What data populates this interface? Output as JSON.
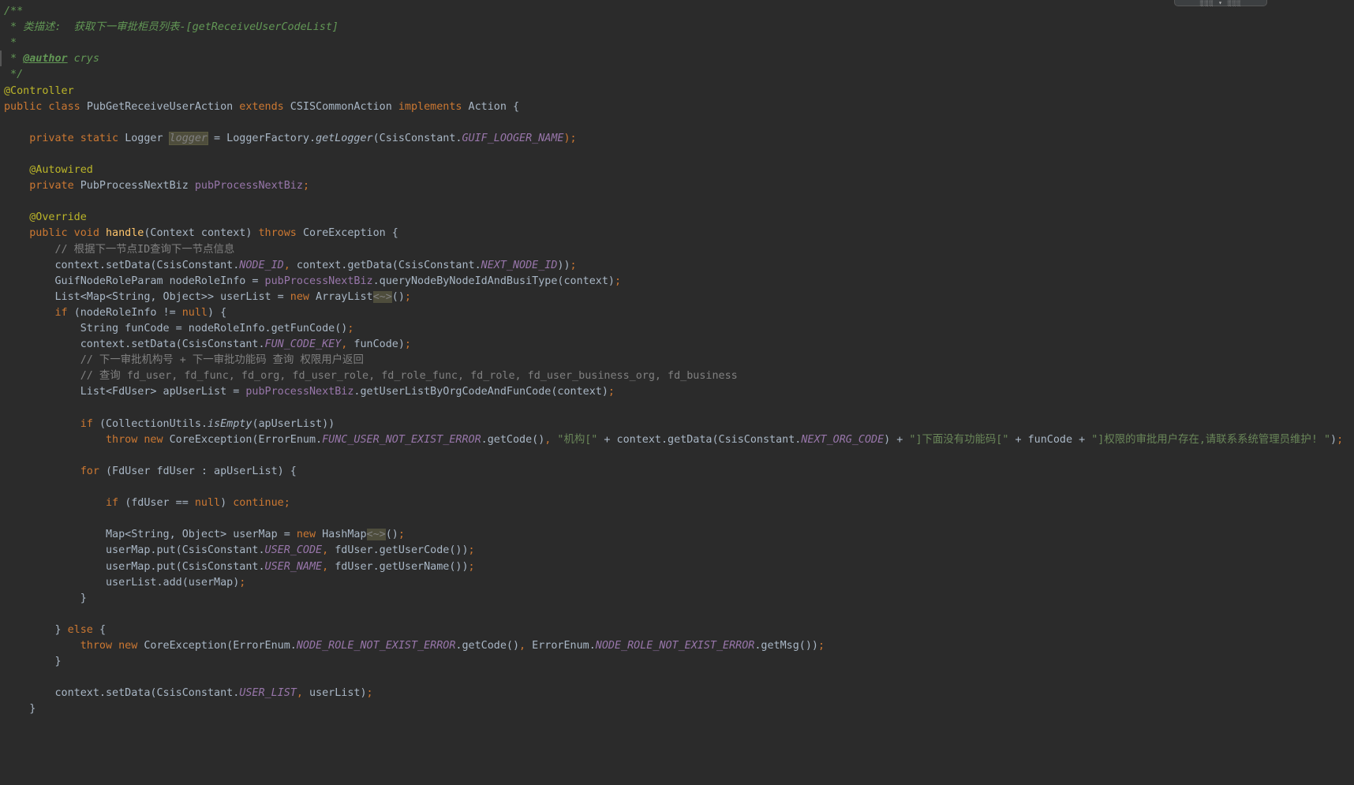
{
  "editor": {
    "colors": {
      "background": "#2b2b2b",
      "keyword": "#cc7832",
      "annotation": "#bbb529",
      "doc_comment": "#629755",
      "line_comment": "#808080",
      "field": "#9876aa",
      "method_decl": "#ffc66d",
      "string": "#6a8759",
      "default": "#a9b7c6"
    },
    "toolbar_glyphs": "░░░ ▾ ░░░",
    "lines": [
      [
        {
          "t": "/**",
          "c": "cm"
        }
      ],
      [
        {
          "t": " * 类描述:  获取下一审批柜员列表-[getReceiveUserCodeList]",
          "c": "cm"
        }
      ],
      [
        {
          "t": " *",
          "c": "cm"
        }
      ],
      [
        {
          "t": " * ",
          "c": "cm"
        },
        {
          "t": "@author",
          "c": "cm-tag"
        },
        {
          "t": " crys",
          "c": "cm"
        }
      ],
      [
        {
          "t": " */",
          "c": "cm"
        }
      ],
      [
        {
          "t": "@Controller",
          "c": "ann"
        }
      ],
      [
        {
          "t": "public class ",
          "c": "kw"
        },
        {
          "t": "PubGetReceiveUserAction ",
          "c": ""
        },
        {
          "t": "extends ",
          "c": "kw"
        },
        {
          "t": "CSISCommonAction ",
          "c": ""
        },
        {
          "t": "implements ",
          "c": "kw"
        },
        {
          "t": "Action {",
          "c": ""
        }
      ],
      [],
      [
        {
          "t": "    ",
          "c": ""
        },
        {
          "t": "private static ",
          "c": "kw"
        },
        {
          "t": "Logger ",
          "c": ""
        },
        {
          "t": "logger",
          "c": "hl-logger"
        },
        {
          "t": " = LoggerFactory.",
          "c": ""
        },
        {
          "t": "getLogger",
          "c": "static-call"
        },
        {
          "t": "(CsisConstant.",
          "c": ""
        },
        {
          "t": "GUIF_LOOGER_NAME",
          "c": "const"
        },
        {
          "t": ");",
          "c": "kw"
        }
      ],
      [],
      [
        {
          "t": "    ",
          "c": ""
        },
        {
          "t": "@Autowired",
          "c": "ann"
        }
      ],
      [
        {
          "t": "    ",
          "c": ""
        },
        {
          "t": "private ",
          "c": "kw"
        },
        {
          "t": "PubProcessNextBiz ",
          "c": ""
        },
        {
          "t": "pubProcessNextBiz",
          "c": "field"
        },
        {
          "t": ";",
          "c": "kw"
        }
      ],
      [],
      [
        {
          "t": "    ",
          "c": ""
        },
        {
          "t": "@Override",
          "c": "ann"
        }
      ],
      [
        {
          "t": "    ",
          "c": ""
        },
        {
          "t": "public void ",
          "c": "kw"
        },
        {
          "t": "handle",
          "c": "method"
        },
        {
          "t": "(Context context) ",
          "c": ""
        },
        {
          "t": "throws ",
          "c": "kw"
        },
        {
          "t": "CoreException {",
          "c": ""
        }
      ],
      [
        {
          "t": "        // 根据下一节点ID查询下一节点信息",
          "c": "lc"
        }
      ],
      [
        {
          "t": "        context.setData(CsisConstant.",
          "c": ""
        },
        {
          "t": "NODE_ID",
          "c": "const"
        },
        {
          "t": ", ",
          "c": "kw"
        },
        {
          "t": "context.getData(CsisConstant.",
          "c": ""
        },
        {
          "t": "NEXT_NODE_ID",
          "c": "const"
        },
        {
          "t": "))",
          "c": ""
        },
        {
          "t": ";",
          "c": "kw"
        }
      ],
      [
        {
          "t": "        GuifNodeRoleParam nodeRoleInfo = ",
          "c": ""
        },
        {
          "t": "pubProcessNextBiz",
          "c": "field"
        },
        {
          "t": ".queryNodeByNodeIdAndBusiType(context)",
          "c": ""
        },
        {
          "t": ";",
          "c": "kw"
        }
      ],
      [
        {
          "t": "        List<Map<String, Object>> userList = ",
          "c": ""
        },
        {
          "t": "new ",
          "c": "kw"
        },
        {
          "t": "ArrayList",
          "c": ""
        },
        {
          "t": "<~>",
          "c": "hl-diamond"
        },
        {
          "t": "()",
          "c": ""
        },
        {
          "t": ";",
          "c": "kw"
        }
      ],
      [
        {
          "t": "        ",
          "c": ""
        },
        {
          "t": "if ",
          "c": "kw"
        },
        {
          "t": "(nodeRoleInfo != ",
          "c": ""
        },
        {
          "t": "null",
          "c": "kw"
        },
        {
          "t": ") {",
          "c": ""
        }
      ],
      [
        {
          "t": "            String funCode = nodeRoleInfo.getFunCode()",
          "c": ""
        },
        {
          "t": ";",
          "c": "kw"
        }
      ],
      [
        {
          "t": "            context.setData(CsisConstant.",
          "c": ""
        },
        {
          "t": "FUN_CODE_KEY",
          "c": "const"
        },
        {
          "t": ", ",
          "c": "kw"
        },
        {
          "t": "funCode)",
          "c": ""
        },
        {
          "t": ";",
          "c": "kw"
        }
      ],
      [
        {
          "t": "            // 下一审批机构号 + 下一审批功能码 查询 权限用户返回",
          "c": "lc"
        }
      ],
      [
        {
          "t": "            // 查询 fd_user, fd_func, fd_org, fd_user_role, fd_role_func, fd_role, fd_user_business_org, fd_business",
          "c": "lc"
        }
      ],
      [
        {
          "t": "            List<FdUser> apUserList = ",
          "c": ""
        },
        {
          "t": "pubProcessNextBiz",
          "c": "field"
        },
        {
          "t": ".getUserListByOrgCodeAndFunCode(context)",
          "c": ""
        },
        {
          "t": ";",
          "c": "kw"
        }
      ],
      [],
      [
        {
          "t": "            ",
          "c": ""
        },
        {
          "t": "if ",
          "c": "kw"
        },
        {
          "t": "(CollectionUtils.",
          "c": ""
        },
        {
          "t": "isEmpty",
          "c": "static-call"
        },
        {
          "t": "(apUserList))",
          "c": ""
        }
      ],
      [
        {
          "t": "                ",
          "c": ""
        },
        {
          "t": "throw new ",
          "c": "kw"
        },
        {
          "t": "CoreException(ErrorEnum.",
          "c": ""
        },
        {
          "t": "FUNC_USER_NOT_EXIST_ERROR",
          "c": "const"
        },
        {
          "t": ".getCode()",
          "c": ""
        },
        {
          "t": ", ",
          "c": "kw"
        },
        {
          "t": "\"机构[\"",
          "c": "str"
        },
        {
          "t": " + context.getData(CsisConstant.",
          "c": ""
        },
        {
          "t": "NEXT_ORG_CODE",
          "c": "const"
        },
        {
          "t": ") + ",
          "c": ""
        },
        {
          "t": "\"]下面没有功能码[\"",
          "c": "str"
        },
        {
          "t": " + funCode + ",
          "c": ""
        },
        {
          "t": "\"]权限的审批用户存在,请联系系统管理员维护! \"",
          "c": "str"
        },
        {
          "t": ")",
          "c": ""
        },
        {
          "t": ";",
          "c": "kw"
        }
      ],
      [],
      [
        {
          "t": "            ",
          "c": ""
        },
        {
          "t": "for ",
          "c": "kw"
        },
        {
          "t": "(FdUser fdUser : apUserList) {",
          "c": ""
        }
      ],
      [],
      [
        {
          "t": "                ",
          "c": ""
        },
        {
          "t": "if ",
          "c": "kw"
        },
        {
          "t": "(fdUser == ",
          "c": ""
        },
        {
          "t": "null",
          "c": "kw"
        },
        {
          "t": ") ",
          "c": ""
        },
        {
          "t": "continue;",
          "c": "kw"
        }
      ],
      [],
      [
        {
          "t": "                Map<String, Object> userMap = ",
          "c": ""
        },
        {
          "t": "new ",
          "c": "kw"
        },
        {
          "t": "HashMap",
          "c": ""
        },
        {
          "t": "<~>",
          "c": "hl-diamond"
        },
        {
          "t": "()",
          "c": ""
        },
        {
          "t": ";",
          "c": "kw"
        }
      ],
      [
        {
          "t": "                userMap.put(CsisConstant.",
          "c": ""
        },
        {
          "t": "USER_CODE",
          "c": "const"
        },
        {
          "t": ", ",
          "c": "kw"
        },
        {
          "t": "fdUser.getUserCode())",
          "c": ""
        },
        {
          "t": ";",
          "c": "kw"
        }
      ],
      [
        {
          "t": "                userMap.put(CsisConstant.",
          "c": ""
        },
        {
          "t": "USER_NAME",
          "c": "const"
        },
        {
          "t": ", ",
          "c": "kw"
        },
        {
          "t": "fdUser.getUserName())",
          "c": ""
        },
        {
          "t": ";",
          "c": "kw"
        }
      ],
      [
        {
          "t": "                userList.add(userMap)",
          "c": ""
        },
        {
          "t": ";",
          "c": "kw"
        }
      ],
      [
        {
          "t": "            }",
          "c": ""
        }
      ],
      [],
      [
        {
          "t": "        } ",
          "c": ""
        },
        {
          "t": "else ",
          "c": "kw"
        },
        {
          "t": "{",
          "c": ""
        }
      ],
      [
        {
          "t": "            ",
          "c": ""
        },
        {
          "t": "throw new ",
          "c": "kw"
        },
        {
          "t": "CoreException(ErrorEnum.",
          "c": ""
        },
        {
          "t": "NODE_ROLE_NOT_EXIST_ERROR",
          "c": "const"
        },
        {
          "t": ".getCode()",
          "c": ""
        },
        {
          "t": ", ",
          "c": "kw"
        },
        {
          "t": "ErrorEnum.",
          "c": ""
        },
        {
          "t": "NODE_ROLE_NOT_EXIST_ERROR",
          "c": "const"
        },
        {
          "t": ".getMsg())",
          "c": ""
        },
        {
          "t": ";",
          "c": "kw"
        }
      ],
      [
        {
          "t": "        }",
          "c": ""
        }
      ],
      [],
      [
        {
          "t": "        context.setData(CsisConstant.",
          "c": ""
        },
        {
          "t": "USER_LIST",
          "c": "const"
        },
        {
          "t": ", ",
          "c": "kw"
        },
        {
          "t": "userList)",
          "c": ""
        },
        {
          "t": ";",
          "c": "kw"
        }
      ],
      [
        {
          "t": "    }",
          "c": ""
        }
      ]
    ]
  }
}
